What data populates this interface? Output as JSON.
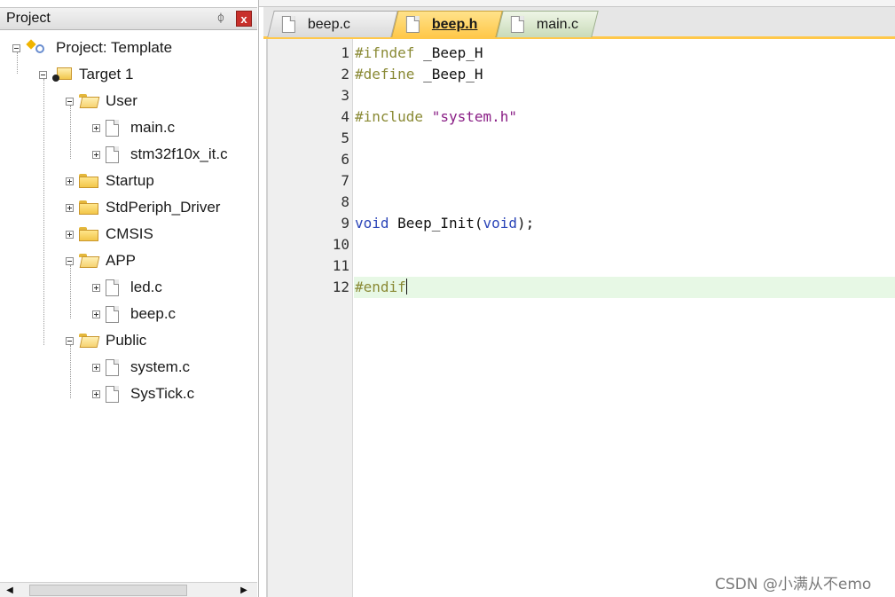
{
  "project_pane": {
    "title": "Project",
    "pin": "ᛰ",
    "close": "x",
    "scroll_left": "◀",
    "scroll_right": "▶"
  },
  "tree": {
    "root": "Project: Template",
    "target": "Target 1",
    "groups": [
      {
        "name": "User",
        "files": [
          "main.c",
          "stm32f10x_it.c"
        ]
      },
      {
        "name": "Startup"
      },
      {
        "name": "StdPeriph_Driver"
      },
      {
        "name": "CMSIS"
      },
      {
        "name": "APP",
        "files": [
          "led.c",
          "beep.c"
        ]
      },
      {
        "name": "Public",
        "files": [
          "system.c",
          "SysTick.c"
        ]
      }
    ]
  },
  "tabs": [
    {
      "label": "beep.c",
      "active": false
    },
    {
      "label": "beep.h",
      "active": true
    },
    {
      "label": "main.c",
      "active": false
    }
  ],
  "editor": {
    "lines": [
      {
        "n": "1",
        "tokens": [
          {
            "t": "#ifndef",
            "c": "pp"
          },
          {
            "t": " _Beep_H",
            "c": ""
          }
        ]
      },
      {
        "n": "2",
        "tokens": [
          {
            "t": "#define",
            "c": "pp"
          },
          {
            "t": " _Beep_H",
            "c": ""
          }
        ]
      },
      {
        "n": "3",
        "tokens": []
      },
      {
        "n": "4",
        "tokens": [
          {
            "t": "#include",
            "c": "pp"
          },
          {
            "t": " ",
            "c": ""
          },
          {
            "t": "\"system.h\"",
            "c": "str"
          }
        ]
      },
      {
        "n": "5",
        "tokens": []
      },
      {
        "n": "6",
        "tokens": []
      },
      {
        "n": "7",
        "tokens": []
      },
      {
        "n": "8",
        "tokens": []
      },
      {
        "n": "9",
        "tokens": [
          {
            "t": "void",
            "c": "kw"
          },
          {
            "t": " Beep_Init(",
            "c": ""
          },
          {
            "t": "void",
            "c": "kw"
          },
          {
            "t": ");",
            "c": ""
          }
        ]
      },
      {
        "n": "10",
        "tokens": []
      },
      {
        "n": "11",
        "tokens": []
      },
      {
        "n": "12",
        "tokens": [
          {
            "t": "#endif",
            "c": "pp"
          }
        ],
        "active": true
      }
    ]
  },
  "watermark": "CSDN @小满从不emo",
  "colors": {
    "active_tab": "#ffc84a",
    "active_line": "#e7f8e5",
    "preprocessor": "#8a8a35",
    "string": "#8a1f86",
    "keyword": "#2b45b8"
  }
}
